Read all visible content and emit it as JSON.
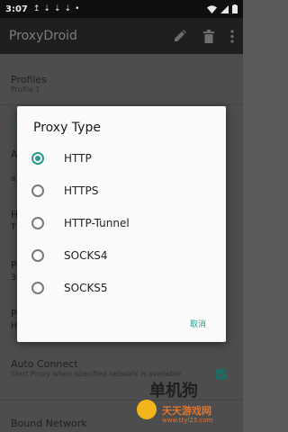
{
  "status": {
    "time": "3:07",
    "icons": [
      "↥",
      "⇣",
      "⇣",
      "⇣",
      "•"
    ]
  },
  "app": {
    "title": "ProxyDroid"
  },
  "background": {
    "profiles_title": "Profiles",
    "profiles_sub": "Profile 1",
    "p_a": "P",
    "p_b": "A",
    "p_c": "a",
    "p_d": "H",
    "p_e": "T",
    "p_f": "P",
    "p_g": "3",
    "p_h": "P",
    "p_i": "P",
    "p_j": "H",
    "auto_connect_title": "Auto Connect",
    "auto_connect_sub": "Start Proxy when specified network is available",
    "bound_network_title": "Bound Network"
  },
  "dialog": {
    "title": "Proxy Type",
    "options": [
      {
        "label": "HTTP",
        "checked": true
      },
      {
        "label": "HTTPS",
        "checked": false
      },
      {
        "label": "HTTP-Tunnel",
        "checked": false
      },
      {
        "label": "SOCKS4",
        "checked": false
      },
      {
        "label": "SOCKS5",
        "checked": false
      }
    ],
    "cancel_label": "取消"
  },
  "watermark": {
    "text": "单机狗",
    "site": "天天游戏网",
    "url": "www.ttyl23.com"
  },
  "colors": {
    "accent": "#2a9d8f",
    "dim_teal": "#1d5c56"
  }
}
